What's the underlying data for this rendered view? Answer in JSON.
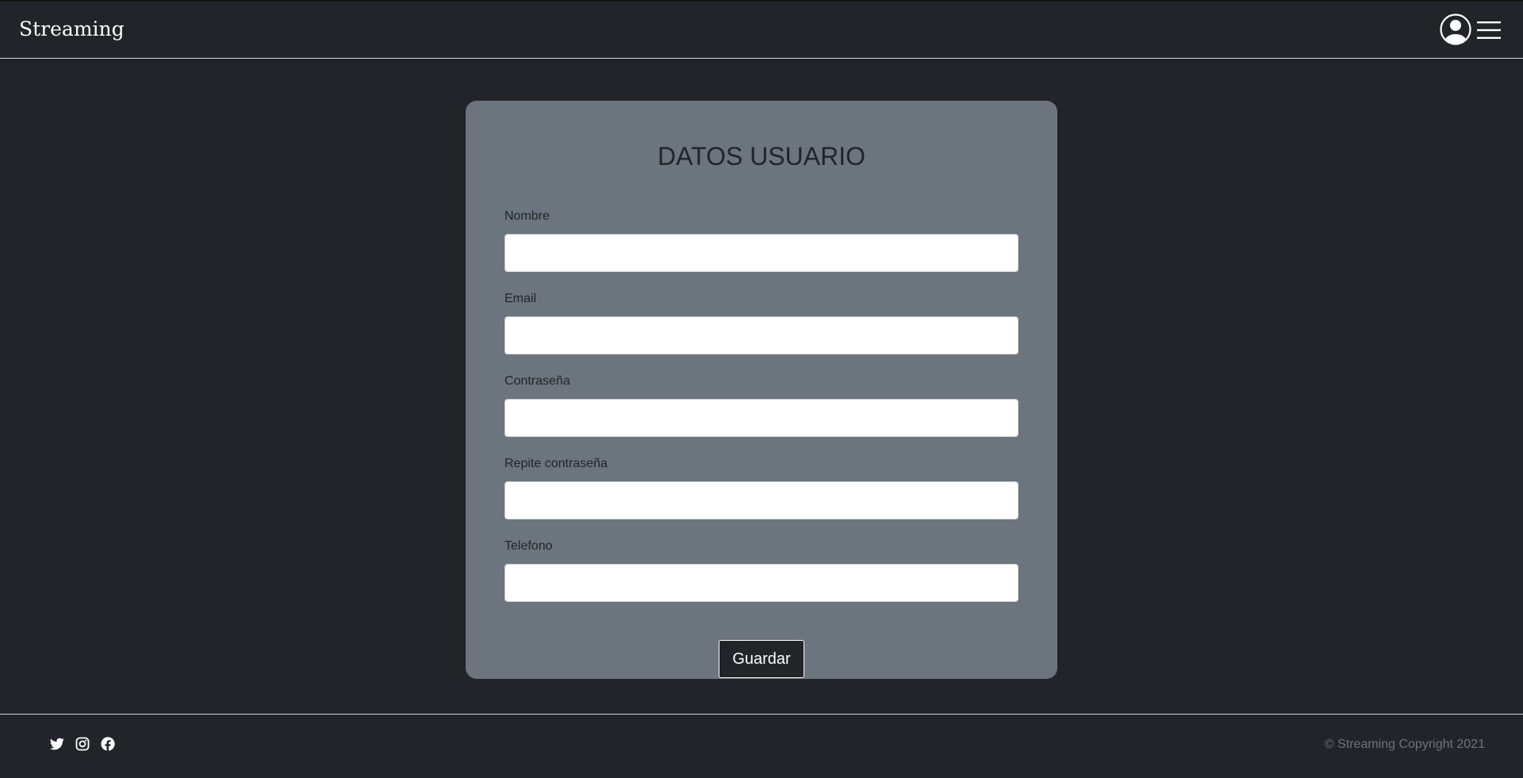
{
  "navbar": {
    "brand": "Streaming",
    "icons": [
      "user-circle-icon",
      "hamburger-menu-icon"
    ]
  },
  "form": {
    "title": "DATOS USUARIO",
    "fields": [
      {
        "label": "Nombre",
        "value": ""
      },
      {
        "label": "Email",
        "value": ""
      },
      {
        "label": "Contraseña",
        "value": ""
      },
      {
        "label": "Repite contraseña",
        "value": ""
      },
      {
        "label": "Telefono",
        "value": ""
      }
    ],
    "submit_label": "Guardar"
  },
  "footer": {
    "social_icons": [
      "twitter-icon",
      "instagram-icon",
      "facebook-icon"
    ],
    "copyright": "© Streaming Copyright 2021"
  },
  "colors": {
    "background": "#212529",
    "card": "#6c757d",
    "text_dark": "#212529",
    "text_muted": "#6c757d",
    "white": "#ffffff"
  }
}
